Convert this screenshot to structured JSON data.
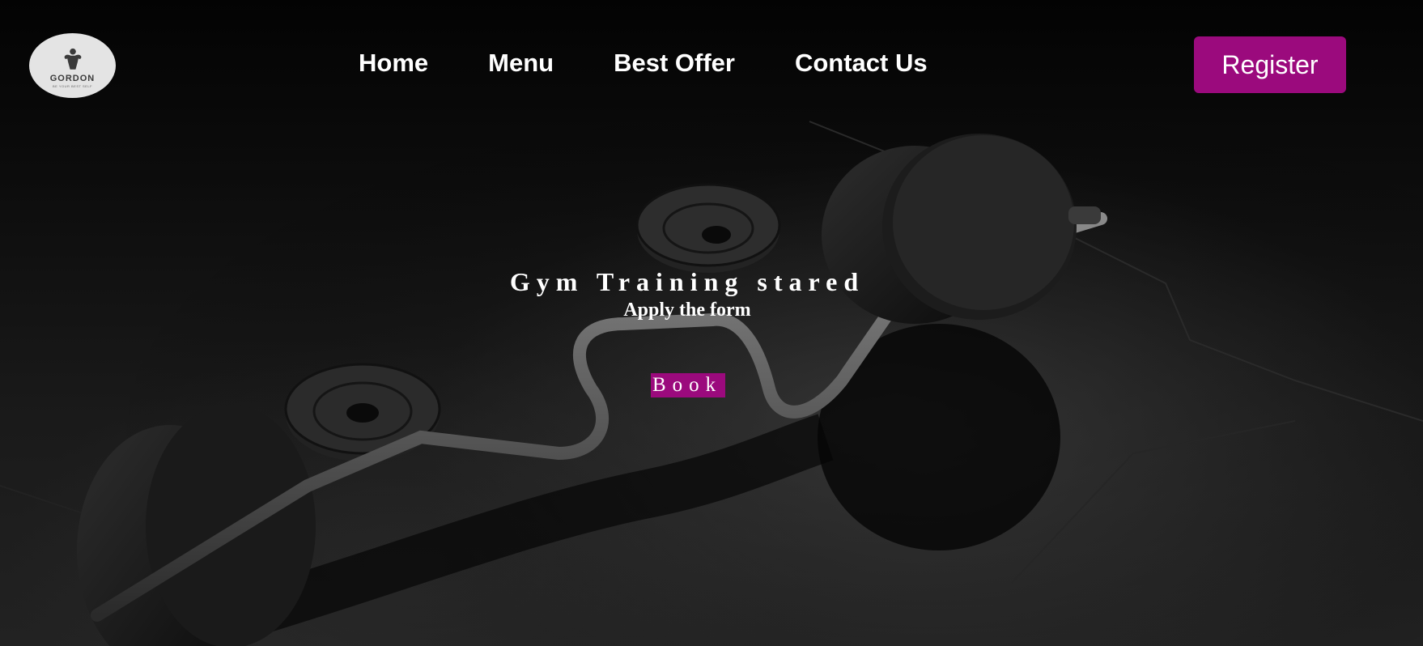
{
  "brand": {
    "name": "GORDON",
    "tagline": "BE YOUR BEST SELF"
  },
  "nav": {
    "items": [
      "Home",
      "Menu",
      "Best Offer",
      "Contact Us"
    ],
    "register_label": "Register"
  },
  "hero": {
    "title": "Gym Training stared",
    "subtitle": "Apply the form",
    "book_label": "Book"
  },
  "colors": {
    "accent": "#9b0a7d",
    "background": "#0b0b0b",
    "text": "#ffffff"
  },
  "icons": {
    "logo": "bodybuilder-icon",
    "hero_image": "barbell-image"
  }
}
